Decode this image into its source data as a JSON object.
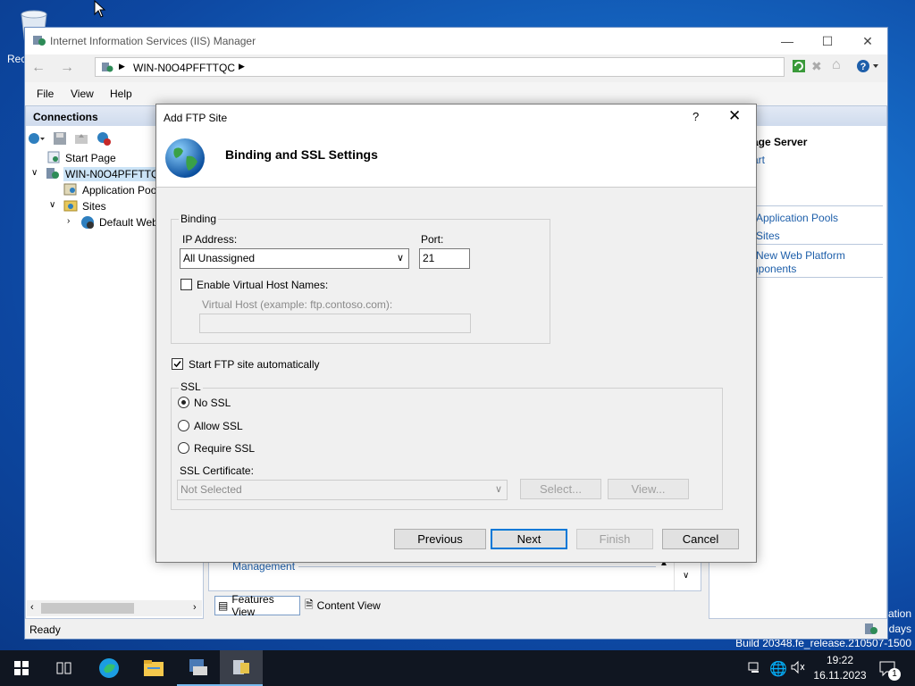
{
  "desktop": {
    "recycle_label": "Rec",
    "activation_line1": "ation",
    "activation_line2": "days",
    "build": "Build 20348.fe_release.210507-1500"
  },
  "iis": {
    "title": "Internet Information Services (IIS) Manager",
    "address": "WIN-N0O4PFFTTQC",
    "menu": [
      "File",
      "View",
      "Help"
    ],
    "connections_header": "Connections",
    "tree": [
      "Start Page",
      "WIN-N0O4PFFTTQC",
      "Application Poo",
      "Sites",
      "Default Web"
    ],
    "actions": {
      "title": "age Server",
      "start": "art",
      "app_pools": "Application Pools",
      "sites": "Sites",
      "web_platform_1": "New Web Platform",
      "web_platform_2": "nponents"
    },
    "management": "Management",
    "features_view": "Features View",
    "content_view": "Content View",
    "status": "Ready"
  },
  "dialog": {
    "title": "Add FTP Site",
    "help": "?",
    "heading": "Binding and SSL Settings",
    "binding_group": "Binding",
    "ip_label": "IP Address:",
    "ip_value": "All Unassigned",
    "port_label": "Port:",
    "port_value": "21",
    "vhost_check": "Enable Virtual Host Names:",
    "vhost_label": "Virtual Host (example: ftp.contoso.com):",
    "vhost_value": "",
    "start_auto": "Start FTP site automatically",
    "ssl_group": "SSL",
    "no_ssl": "No SSL",
    "allow_ssl": "Allow SSL",
    "require_ssl": "Require SSL",
    "cert_label": "SSL Certificate:",
    "cert_value": "Not Selected",
    "select_btn": "Select...",
    "view_btn": "View...",
    "previous": "Previous",
    "next": "Next",
    "finish": "Finish",
    "cancel": "Cancel"
  },
  "taskbar": {
    "time": "19:22",
    "date": "16.11.2023",
    "notif_count": "1"
  }
}
